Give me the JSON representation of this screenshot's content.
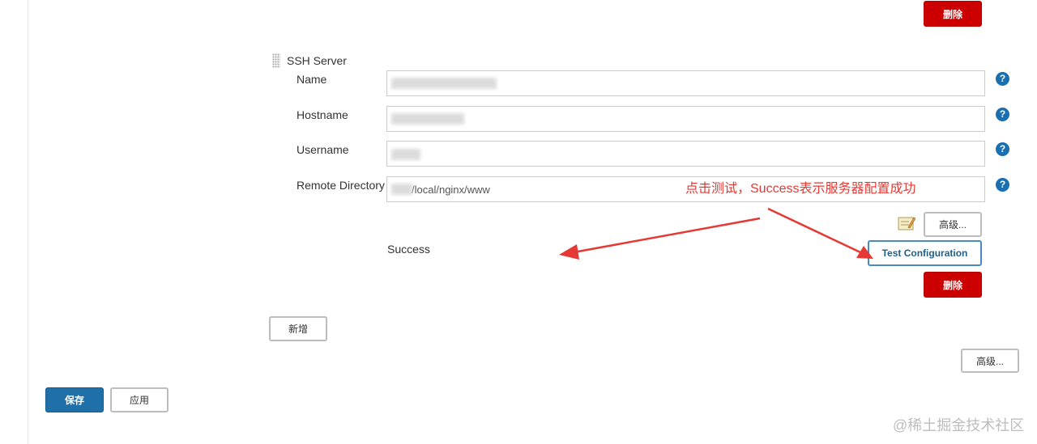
{
  "buttons": {
    "delete_top": "删除",
    "advanced_inner": "高级...",
    "test_configuration": "Test Configuration",
    "delete_bottom": "删除",
    "add_new": "新增",
    "advanced_outer": "高级...",
    "save": "保存",
    "apply": "应用"
  },
  "ssh_server": {
    "section_title": "SSH Server",
    "fields": [
      {
        "label": "Name",
        "value": ""
      },
      {
        "label": "Hostname",
        "value": ""
      },
      {
        "label": "Username",
        "value": ""
      },
      {
        "label": "Remote Directory",
        "value": "/local/nginx/www"
      }
    ],
    "status_text": "Success"
  },
  "annotation": {
    "text": "点击测试，Success表示服务器配置成功",
    "color": "#e53935"
  },
  "watermark": "@稀土掘金技术社区",
  "colors": {
    "danger": "#cc0000",
    "primary": "#1f6fa8",
    "help": "#1a6fb0"
  }
}
